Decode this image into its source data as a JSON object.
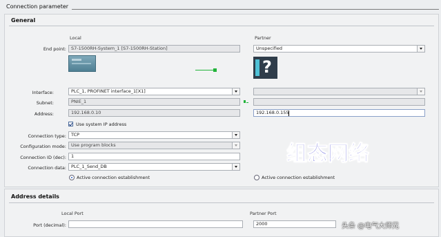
{
  "header": {
    "title": "Connection parameter"
  },
  "general": {
    "title": "General",
    "col_local": "Local",
    "col_partner": "Partner",
    "labels": {
      "end_point": "End point:",
      "interface": "Interface:",
      "subnet": "Subnet:",
      "address": "Address:",
      "connection_type": "Connection type:",
      "configuration_mode": "Configuration mode:",
      "connection_id": "Connection ID (dec):",
      "connection_data": "Connection data:"
    },
    "local": {
      "end_point": "S7-1500RH-System_1 [S7-1500RH-Station]",
      "interface": "PLC_1, PROFINET interface_1[X1]",
      "subnet": "PNIE_1",
      "address": "192.168.0.10",
      "use_system_ip": "Use system IP address",
      "connection_type": "TCP",
      "configuration_mode": "Use program blocks",
      "connection_id": "1",
      "connection_data": "PLC_1_Send_DB",
      "active_connection": "Active connection establishment"
    },
    "partner": {
      "end_point": "Unspecified",
      "interface": "",
      "subnet": "",
      "address": "192.168.0.155",
      "active_connection": "Active connection establishment"
    }
  },
  "address_details": {
    "title": "Address details",
    "col_local": "Local Port",
    "col_partner": "Partner Port",
    "port_label": "Port (decimal):",
    "local_port": "",
    "partner_port": "2000"
  },
  "watermark": {
    "main": "组态网络",
    "credit": "头条 @电气大师兄"
  },
  "colors": {
    "watermark": "#1212c8",
    "link_green": "#22b33a",
    "device_teal": "#5aa0b5"
  }
}
